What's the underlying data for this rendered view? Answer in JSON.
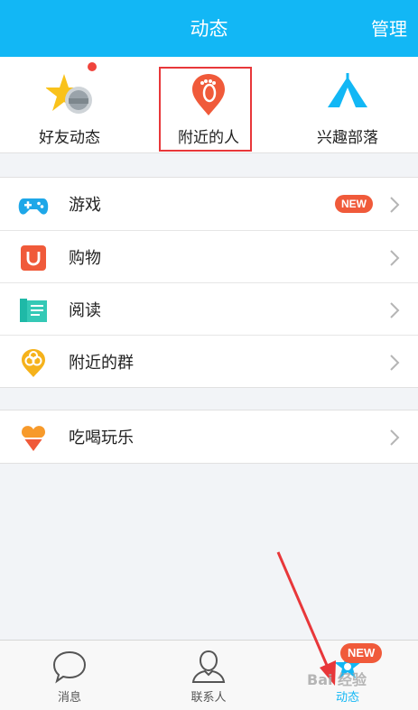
{
  "header": {
    "title": "动态",
    "manage_label": "管理"
  },
  "top_nav": {
    "items": [
      {
        "label": "好友动态",
        "icon": "friends-star-icon"
      },
      {
        "label": "附近的人",
        "icon": "footprint-pin-icon"
      },
      {
        "label": "兴趣部落",
        "icon": "tent-icon"
      }
    ],
    "unread_dot_color": "#f0443c"
  },
  "list_group_1": [
    {
      "label": "游戏",
      "icon": "gamepad-icon",
      "badge": "NEW"
    },
    {
      "label": "购物",
      "icon": "shopping-bag-icon"
    },
    {
      "label": "阅读",
      "icon": "book-icon"
    },
    {
      "label": "附近的群",
      "icon": "group-pin-icon"
    }
  ],
  "list_group_2": [
    {
      "label": "吃喝玩乐",
      "icon": "heart-bag-icon"
    }
  ],
  "tabbar": {
    "items": [
      {
        "label": "消息",
        "icon": "chat-bubble-icon"
      },
      {
        "label": "联系人",
        "icon": "person-icon"
      },
      {
        "label": "动态",
        "icon": "paw-star-icon",
        "active": true
      }
    ],
    "badge": "NEW"
  },
  "colors": {
    "brand": "#12b7f5",
    "badge": "#f05a3a",
    "annotation": "#e8373a"
  },
  "watermark": "Bai 经验"
}
